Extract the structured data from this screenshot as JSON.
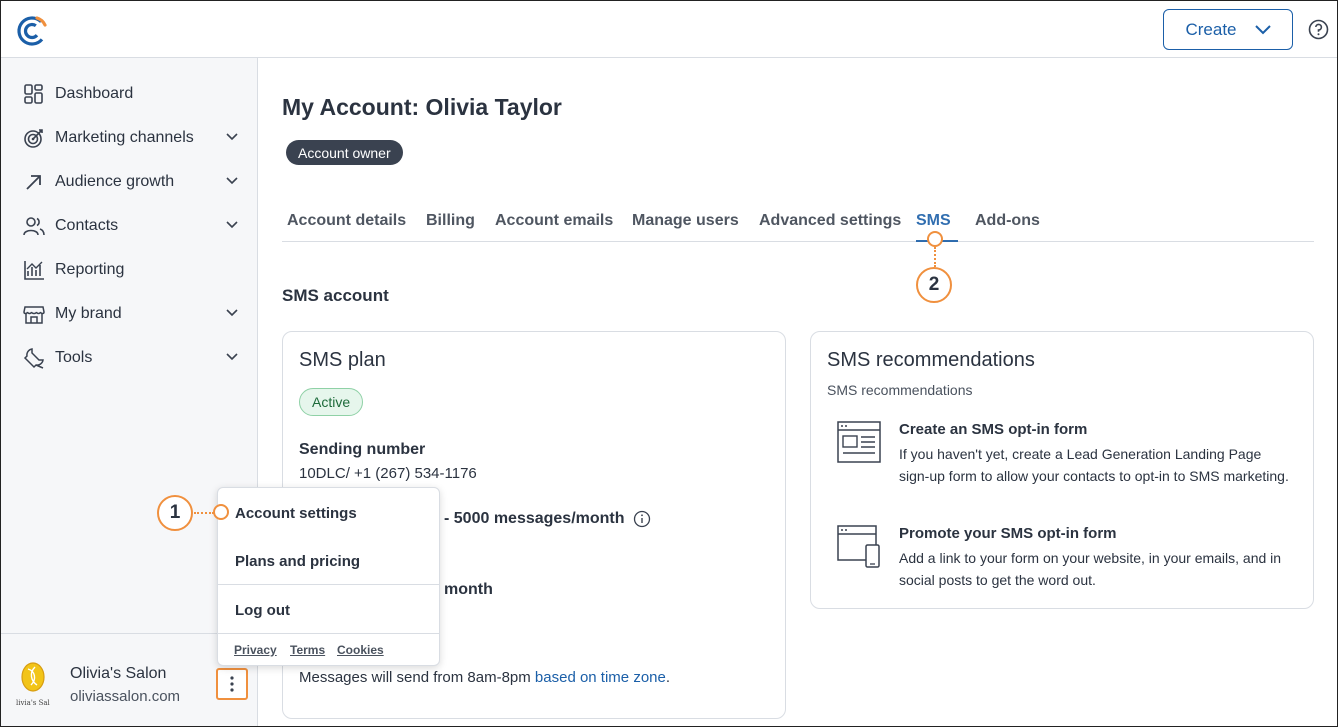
{
  "header": {
    "create_label": "Create",
    "brand_color": "#1b5fa8",
    "accent_color": "#f0903e"
  },
  "sidebar": {
    "items": [
      {
        "label": "Dashboard",
        "icon": "dashboard-icon",
        "expandable": false
      },
      {
        "label": "Marketing channels",
        "icon": "target-icon",
        "expandable": true
      },
      {
        "label": "Audience growth",
        "icon": "arrow-up-right-icon",
        "expandable": true
      },
      {
        "label": "Contacts",
        "icon": "people-icon",
        "expandable": true
      },
      {
        "label": "Reporting",
        "icon": "chart-icon",
        "expandable": false
      },
      {
        "label": "My brand",
        "icon": "storefront-icon",
        "expandable": true
      },
      {
        "label": "Tools",
        "icon": "wrench-icon",
        "expandable": true
      }
    ],
    "org_name": "Olivia's Salon",
    "org_url": "oliviassalon.com",
    "avatar_text": "livia's Sal"
  },
  "page": {
    "title": "My Account: Olivia Taylor",
    "owner_badge": "Account owner",
    "tabs": [
      "Account details",
      "Billing",
      "Account emails",
      "Manage users",
      "Advanced settings",
      "SMS",
      "Add-ons"
    ],
    "active_tab": "SMS",
    "section_title": "SMS account"
  },
  "plan_card": {
    "title": "SMS plan",
    "status": "Active",
    "sending_label": "Sending number",
    "sending_value": "10DLC/ +1 (267) 534-1176",
    "plan_partial": "- 5000 messages/month",
    "month_partial": "month",
    "schedule_text": "Messages will send from 8am-8pm",
    "schedule_link": "based on time zone",
    "schedule_end": "."
  },
  "rec_card": {
    "title": "SMS recommendations",
    "subtitle": "SMS recommendations",
    "items": [
      {
        "title": "Create an SMS opt-in form",
        "desc": "If you haven't yet, create a Lead Generation Landing Page sign-up form to allow your contacts to opt-in to SMS marketing.",
        "icon": "form-layout-icon"
      },
      {
        "title": "Promote your SMS opt-in form",
        "desc": "Add a link to your form on your website, in your emails, and in social posts to get the word out.",
        "icon": "devices-icon"
      }
    ]
  },
  "menu": {
    "account_settings": "Account settings",
    "plans_pricing": "Plans and pricing",
    "log_out": "Log out",
    "privacy": "Privacy",
    "terms": "Terms",
    "cookies": "Cookies"
  },
  "callouts": {
    "one": "1",
    "two": "2"
  }
}
